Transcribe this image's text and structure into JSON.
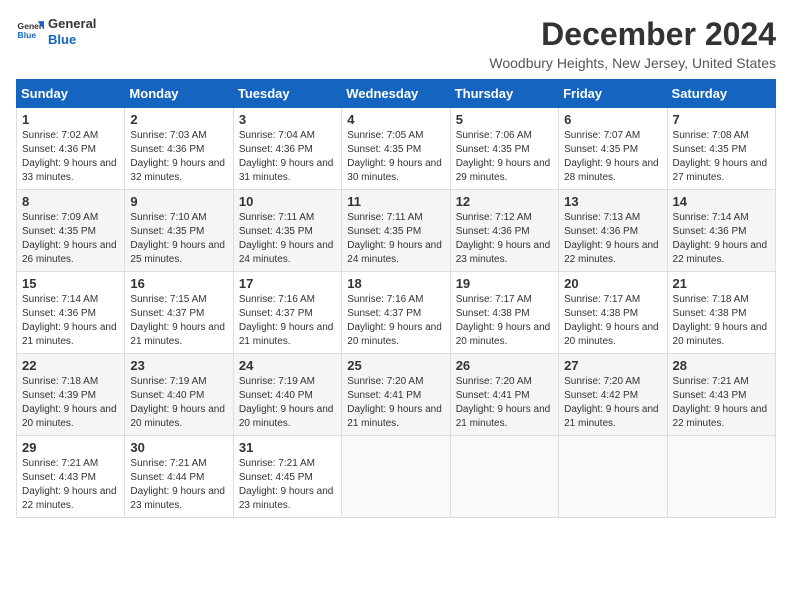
{
  "logo": {
    "line1": "General",
    "line2": "Blue"
  },
  "title": "December 2024",
  "location": "Woodbury Heights, New Jersey, United States",
  "weekdays": [
    "Sunday",
    "Monday",
    "Tuesday",
    "Wednesday",
    "Thursday",
    "Friday",
    "Saturday"
  ],
  "weeks": [
    [
      {
        "day": "1",
        "sunrise": "7:02 AM",
        "sunset": "4:36 PM",
        "daylight": "9 hours and 33 minutes."
      },
      {
        "day": "2",
        "sunrise": "7:03 AM",
        "sunset": "4:36 PM",
        "daylight": "9 hours and 32 minutes."
      },
      {
        "day": "3",
        "sunrise": "7:04 AM",
        "sunset": "4:36 PM",
        "daylight": "9 hours and 31 minutes."
      },
      {
        "day": "4",
        "sunrise": "7:05 AM",
        "sunset": "4:35 PM",
        "daylight": "9 hours and 30 minutes."
      },
      {
        "day": "5",
        "sunrise": "7:06 AM",
        "sunset": "4:35 PM",
        "daylight": "9 hours and 29 minutes."
      },
      {
        "day": "6",
        "sunrise": "7:07 AM",
        "sunset": "4:35 PM",
        "daylight": "9 hours and 28 minutes."
      },
      {
        "day": "7",
        "sunrise": "7:08 AM",
        "sunset": "4:35 PM",
        "daylight": "9 hours and 27 minutes."
      }
    ],
    [
      {
        "day": "8",
        "sunrise": "7:09 AM",
        "sunset": "4:35 PM",
        "daylight": "9 hours and 26 minutes."
      },
      {
        "day": "9",
        "sunrise": "7:10 AM",
        "sunset": "4:35 PM",
        "daylight": "9 hours and 25 minutes."
      },
      {
        "day": "10",
        "sunrise": "7:11 AM",
        "sunset": "4:35 PM",
        "daylight": "9 hours and 24 minutes."
      },
      {
        "day": "11",
        "sunrise": "7:11 AM",
        "sunset": "4:35 PM",
        "daylight": "9 hours and 24 minutes."
      },
      {
        "day": "12",
        "sunrise": "7:12 AM",
        "sunset": "4:36 PM",
        "daylight": "9 hours and 23 minutes."
      },
      {
        "day": "13",
        "sunrise": "7:13 AM",
        "sunset": "4:36 PM",
        "daylight": "9 hours and 22 minutes."
      },
      {
        "day": "14",
        "sunrise": "7:14 AM",
        "sunset": "4:36 PM",
        "daylight": "9 hours and 22 minutes."
      }
    ],
    [
      {
        "day": "15",
        "sunrise": "7:14 AM",
        "sunset": "4:36 PM",
        "daylight": "9 hours and 21 minutes."
      },
      {
        "day": "16",
        "sunrise": "7:15 AM",
        "sunset": "4:37 PM",
        "daylight": "9 hours and 21 minutes."
      },
      {
        "day": "17",
        "sunrise": "7:16 AM",
        "sunset": "4:37 PM",
        "daylight": "9 hours and 21 minutes."
      },
      {
        "day": "18",
        "sunrise": "7:16 AM",
        "sunset": "4:37 PM",
        "daylight": "9 hours and 20 minutes."
      },
      {
        "day": "19",
        "sunrise": "7:17 AM",
        "sunset": "4:38 PM",
        "daylight": "9 hours and 20 minutes."
      },
      {
        "day": "20",
        "sunrise": "7:17 AM",
        "sunset": "4:38 PM",
        "daylight": "9 hours and 20 minutes."
      },
      {
        "day": "21",
        "sunrise": "7:18 AM",
        "sunset": "4:38 PM",
        "daylight": "9 hours and 20 minutes."
      }
    ],
    [
      {
        "day": "22",
        "sunrise": "7:18 AM",
        "sunset": "4:39 PM",
        "daylight": "9 hours and 20 minutes."
      },
      {
        "day": "23",
        "sunrise": "7:19 AM",
        "sunset": "4:40 PM",
        "daylight": "9 hours and 20 minutes."
      },
      {
        "day": "24",
        "sunrise": "7:19 AM",
        "sunset": "4:40 PM",
        "daylight": "9 hours and 20 minutes."
      },
      {
        "day": "25",
        "sunrise": "7:20 AM",
        "sunset": "4:41 PM",
        "daylight": "9 hours and 21 minutes."
      },
      {
        "day": "26",
        "sunrise": "7:20 AM",
        "sunset": "4:41 PM",
        "daylight": "9 hours and 21 minutes."
      },
      {
        "day": "27",
        "sunrise": "7:20 AM",
        "sunset": "4:42 PM",
        "daylight": "9 hours and 21 minutes."
      },
      {
        "day": "28",
        "sunrise": "7:21 AM",
        "sunset": "4:43 PM",
        "daylight": "9 hours and 22 minutes."
      }
    ],
    [
      {
        "day": "29",
        "sunrise": "7:21 AM",
        "sunset": "4:43 PM",
        "daylight": "9 hours and 22 minutes."
      },
      {
        "day": "30",
        "sunrise": "7:21 AM",
        "sunset": "4:44 PM",
        "daylight": "9 hours and 23 minutes."
      },
      {
        "day": "31",
        "sunrise": "7:21 AM",
        "sunset": "4:45 PM",
        "daylight": "9 hours and 23 minutes."
      },
      null,
      null,
      null,
      null
    ]
  ]
}
